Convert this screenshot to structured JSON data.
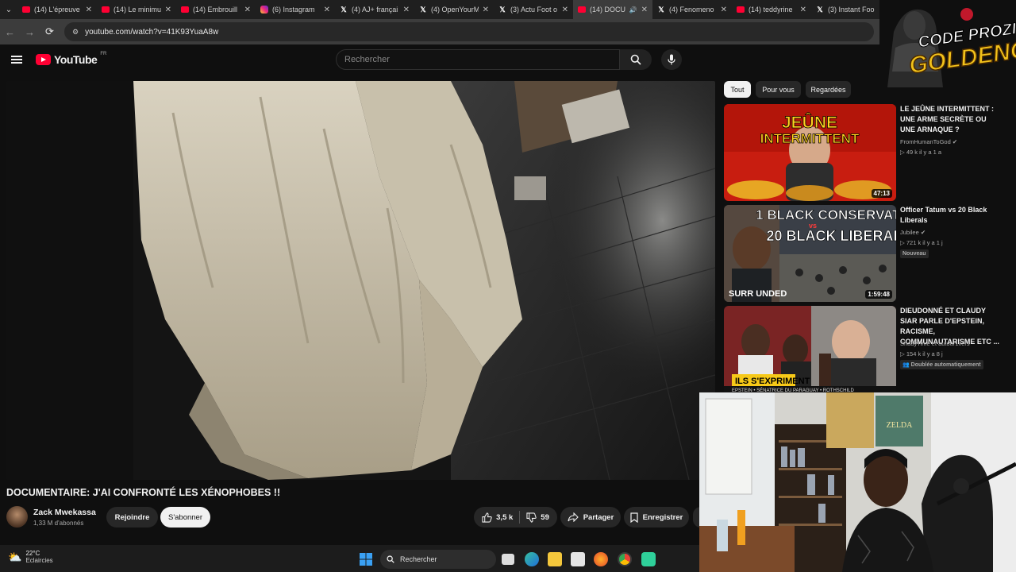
{
  "browser": {
    "tabs": [
      {
        "label": "(14) L'épreuve",
        "favicon": "youtube-icon"
      },
      {
        "label": "(14) Le minimu",
        "favicon": "youtube-icon"
      },
      {
        "label": "(14) Embrouill",
        "favicon": "youtube-icon"
      },
      {
        "label": "(6) Instagram",
        "favicon": "instagram-icon"
      },
      {
        "label": "(4) AJ+ françai",
        "favicon": "x-icon"
      },
      {
        "label": "(4) OpenYourM",
        "favicon": "x-icon"
      },
      {
        "label": "(3) Actu Foot o",
        "favicon": "x-icon"
      },
      {
        "label": "(14) DOCUI",
        "favicon": "youtube-icon",
        "active": true
      },
      {
        "label": "(4) Fenomeno",
        "favicon": "x-icon"
      },
      {
        "label": "(14) teddyrine",
        "favicon": "youtube-icon"
      },
      {
        "label": "(3) Instant Foo",
        "favicon": "x-icon"
      }
    ],
    "url": "youtube.com/watch?v=41K93YuaA8w"
  },
  "header": {
    "logo_text": "YouTube",
    "region": "FR",
    "search_placeholder": "Rechercher"
  },
  "video": {
    "title": "DOCUMENTAIRE: J'AI CONFRONTÉ LES XÉNOPHOBES !!",
    "channel": "Zack Mwekassa",
    "subscribers": "1,33 M d'abonnés",
    "join_label": "Rejoindre",
    "subscribe_label": "S'abonner",
    "likes": "3,5 k",
    "dislikes": "59",
    "share_label": "Partager",
    "save_label": "Enregistrer"
  },
  "filters": [
    "Tout",
    "Pour vous",
    "Regardées"
  ],
  "recommendations": [
    {
      "title": "LE JEÛNE INTERMITTENT : UNE ARME SECRÈTE OU UNE ARNAQUE ?",
      "channel": "FromHumanToGod",
      "meta": "▷ 49 k  il y a 1 a",
      "duration": "47:13",
      "thumb_text": "JEÛNE INTERMITTENT",
      "badge": ""
    },
    {
      "title": "Officer Tatum vs 20 Black Liberals",
      "channel": "Jubilee",
      "meta": "▷ 721 k  il y a 1 j",
      "duration": "1:59:48",
      "thumb_text_1": "1 BLACK CONSERVATIVE",
      "thumb_text_vs": "vs",
      "thumb_text_2": "20 BLACK LIBERALS",
      "thumb_text_3": "SURR UNDED",
      "badge": "Nouveau"
    },
    {
      "title": "DIEUDONNÉ ET CLAUDY SIAR PARLE D'EPSTEIN, RACISME, COMMUNAUTARISME ETC ...",
      "channel": "ShadyTime et autour1vers",
      "meta": "▷ 154 k  il y a 8 j",
      "duration": "1:42:48",
      "thumb_text": "ILS S'EXPRIMENT",
      "thumb_caption": "EPSTEIN • SÉNATRICE DU PARAGUAY • ROTHSCHILD",
      "badge": "Doublée automatiquement"
    }
  ],
  "overlay": {
    "line1": "CODE PROZIS",
    "line2": "GOLDENG"
  },
  "taskbar": {
    "temperature": "22°C",
    "weather": "Eclaircies",
    "search_label": "Rechercher"
  },
  "colors": {
    "youtube_red": "#ff0033",
    "background": "#0f0f0f",
    "overlay_gold": "#f2c21b"
  }
}
